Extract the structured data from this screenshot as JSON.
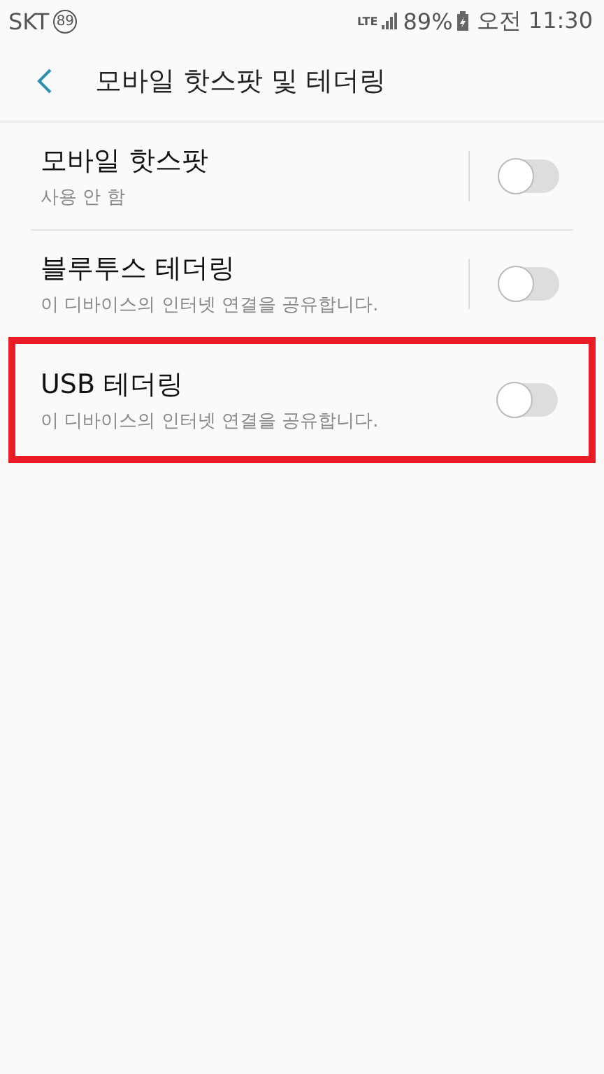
{
  "status_bar": {
    "carrier": "SKT",
    "carrier_badge": "89",
    "network": "LTE",
    "battery": "89%",
    "time": "오전 11:30"
  },
  "header": {
    "title": "모바일 핫스팟 및 테더링"
  },
  "settings": [
    {
      "title": "모바일 핫스팟",
      "subtitle": "사용 안 함",
      "on": false,
      "split": true,
      "highlighted": false
    },
    {
      "title": "블루투스 테더링",
      "subtitle": "이 디바이스의 인터넷 연결을 공유합니다.",
      "on": false,
      "split": true,
      "highlighted": false
    },
    {
      "title": "USB 테더링",
      "subtitle": "이 디바이스의 인터넷 연결을 공유합니다.",
      "on": false,
      "split": false,
      "highlighted": true
    }
  ]
}
